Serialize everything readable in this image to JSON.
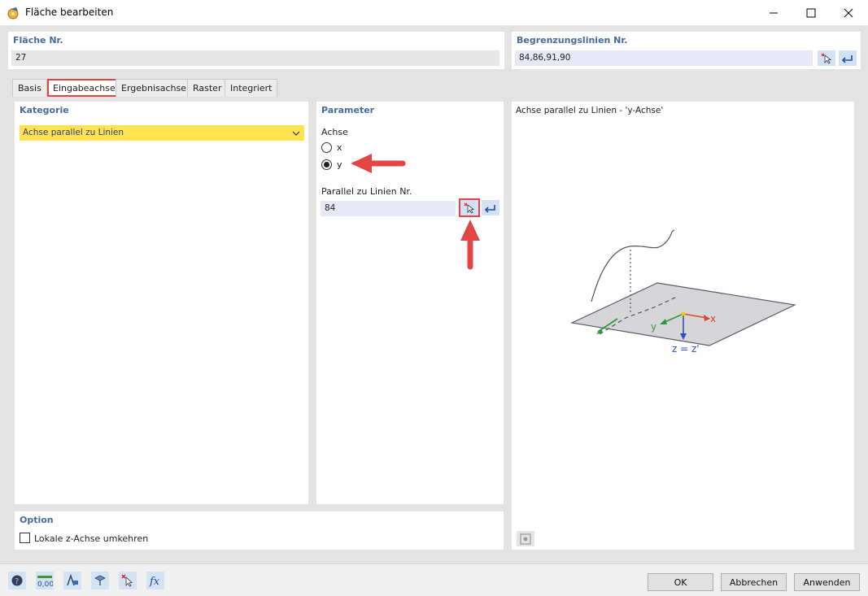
{
  "window": {
    "title": "Fläche bearbeiten",
    "minimize_label": "–",
    "maximize_label": "☐",
    "close_label": "✕"
  },
  "header": {
    "surface_label": "Fläche Nr.",
    "surface_value": "27",
    "boundary_label": "Begrenzungslinien Nr.",
    "boundary_value": "84,86,91,90"
  },
  "tabs": [
    {
      "label": "Basis",
      "active": false
    },
    {
      "label": "Eingabeachsen",
      "active": true
    },
    {
      "label": "Ergebnisachsen",
      "active": false
    },
    {
      "label": "Raster",
      "active": false
    },
    {
      "label": "Integriert",
      "active": false
    }
  ],
  "category": {
    "title": "Kategorie",
    "selected": "Achse parallel zu Linien"
  },
  "parameter": {
    "title": "Parameter",
    "axis_label": "Achse",
    "options": [
      {
        "label": "x",
        "selected": false
      },
      {
        "label": "y",
        "selected": true
      }
    ],
    "parallel_label": "Parallel zu Linien Nr.",
    "parallel_value": "84"
  },
  "option": {
    "title": "Option",
    "checkbox_label": "Lokale z-Achse umkehren",
    "checked": false
  },
  "preview": {
    "title": "Achse parallel zu Linien - 'y-Achse'",
    "axis_x": "x",
    "axis_y": "y",
    "axis_z": "z = z'"
  },
  "footer": {
    "ok_label": "OK",
    "cancel_label": "Abbrechen",
    "apply_label": "Anwenden"
  },
  "colors": {
    "accent": "#e34444",
    "section_title": "#4a6a9a",
    "dropdown": "#ffe24f",
    "icon_button": "#d2e1f3"
  }
}
